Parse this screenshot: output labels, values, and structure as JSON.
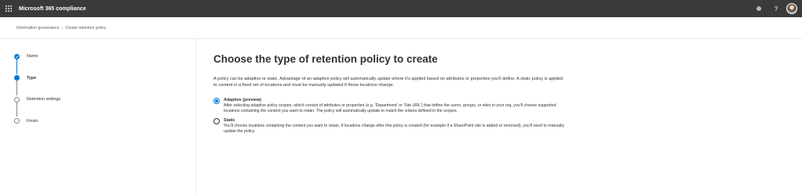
{
  "header": {
    "app_title": "Microsoft 365 compliance",
    "icons": [
      "waffle-icon",
      "gear-icon",
      "help-icon",
      "avatar"
    ],
    "help_glyph": "?",
    "bar_color": "#3b3a39"
  },
  "breadcrumb": {
    "items": [
      "Information governance",
      "Create retention policy"
    ],
    "separator": "›"
  },
  "wizard": {
    "steps": [
      {
        "label": "Name",
        "state": "completed"
      },
      {
        "label": "Type",
        "state": "current"
      },
      {
        "label": "Retention settings",
        "state": "not-started"
      },
      {
        "label": "Finish",
        "state": "not-started"
      }
    ],
    "accent": "#0078d4"
  },
  "main": {
    "title": "Choose the type of retention policy to create",
    "intro": "A policy can be adaptive or static. Advantage of an adaptive policy will automatically update where it's applied based on attributes or properties you'll define. A static policy is applied to content in a fixed set of locations and must be manually updated if those locations change.",
    "options": [
      {
        "title": "Adaptive (preview)",
        "description": "After selecting adaptive policy scopes, which consist of attributes or properties (e.g. 'Department' or 'Site URL') that define the users, groups, or sites in your org, you'll choose supported locations containing the content you want to retain. The policy will automatically update to match the criteria defined in the scopes.",
        "selected": true
      },
      {
        "title": "Static",
        "description": "You'll choose locations containing the content you want to retain. If locations change after this policy is created (for example if a SharePoint site is added or removed), you'll need to manually update the policy.",
        "selected": false
      }
    ]
  }
}
